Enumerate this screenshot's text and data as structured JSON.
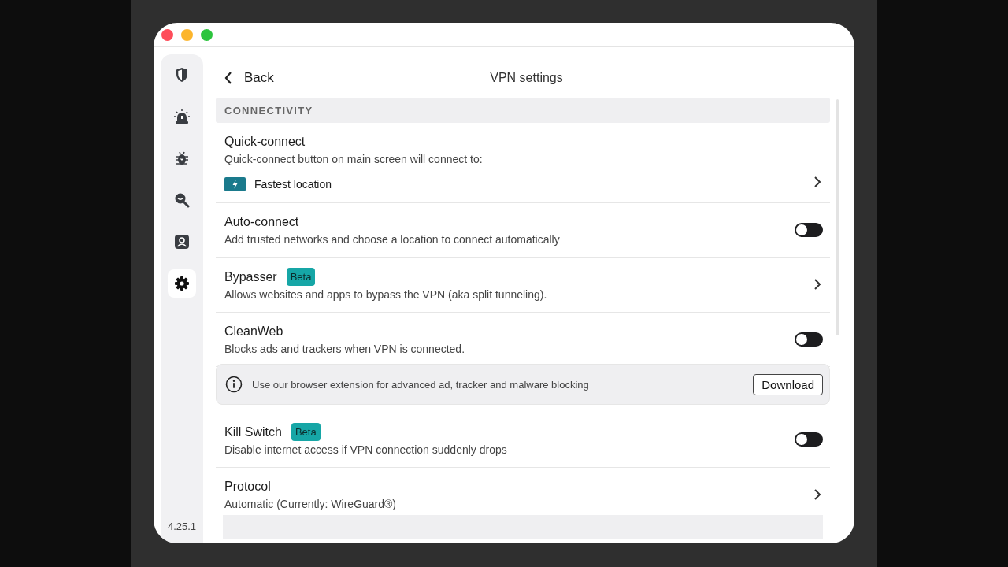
{
  "sidebar": {
    "items": [
      {
        "kind": "shield",
        "selected": false
      },
      {
        "kind": "alarm",
        "selected": false
      },
      {
        "kind": "bug",
        "selected": false
      },
      {
        "kind": "search",
        "selected": false
      },
      {
        "kind": "person",
        "selected": false
      },
      {
        "kind": "gear",
        "selected": true
      }
    ],
    "version": "4.25.1"
  },
  "header": {
    "back": "Back",
    "title": "VPN settings"
  },
  "section": "CONNECTIVITY",
  "rows": [
    {
      "kind": "chevron",
      "title": "Quick-connect",
      "description": "Quick-connect button on main screen will connect to:",
      "location": "Fastest location"
    },
    {
      "kind": "toggle",
      "title": "Auto-connect",
      "description": "Add trusted networks and choose a location to connect automatically",
      "on": false
    },
    {
      "kind": "chevron",
      "title": "Bypasser",
      "badge": "Beta",
      "description": "Allows websites and apps to bypass the VPN (aka split tunneling)."
    },
    {
      "kind": "toggle",
      "title": "CleanWeb",
      "description": "Blocks ads and trackers when VPN is connected.",
      "on": false,
      "banner": {
        "text": "Use our browser extension for advanced ad, tracker and malware blocking",
        "button": "Download"
      }
    },
    {
      "kind": "toggle",
      "title": "Kill Switch",
      "badge": "Beta",
      "description": "Disable internet access if VPN connection suddenly drops",
      "on": false
    },
    {
      "kind": "chevron",
      "title": "Protocol",
      "description": "Automatic (Currently: WireGuard®)"
    }
  ]
}
